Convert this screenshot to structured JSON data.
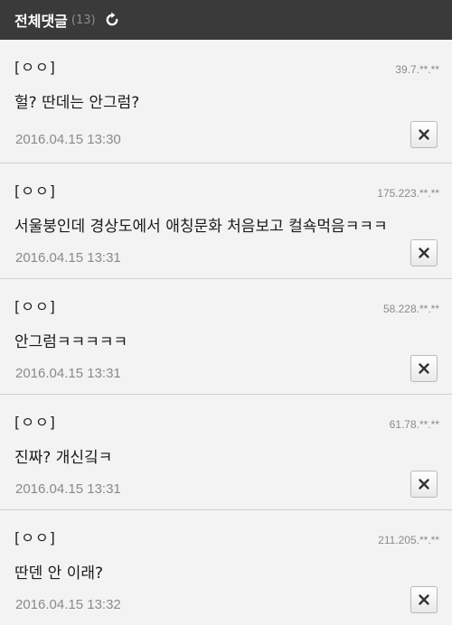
{
  "header": {
    "title": "전체댓글",
    "count": "(13)",
    "refresh_icon": "refresh-icon"
  },
  "comments": [
    {
      "author": "[ㅇㅇ]",
      "ip": "39.7.**.**",
      "text": "헐? 딴데는 안그럼?",
      "date": "2016.04.15 13:30"
    },
    {
      "author": "[ㅇㅇ]",
      "ip": "175.223.**.**",
      "text": "서울붕인데 경상도에서 애칭문화 처음보고 컬쇽먹음ㅋㅋㅋ",
      "date": "2016.04.15 13:31"
    },
    {
      "author": "[ㅇㅇ]",
      "ip": "58.228.**.**",
      "text": "안그럼ㅋㅋㅋㅋㅋ",
      "date": "2016.04.15 13:31"
    },
    {
      "author": "[ㅇㅇ]",
      "ip": "61.78.**.**",
      "text": "진짜? 개신깈ㅋ",
      "date": "2016.04.15 13:31"
    },
    {
      "author": "[ㅇㅇ]",
      "ip": "211.205.**.**",
      "text": "딴덴 안 이래?",
      "date": "2016.04.15 13:32"
    }
  ],
  "delete_icon": "close-icon"
}
